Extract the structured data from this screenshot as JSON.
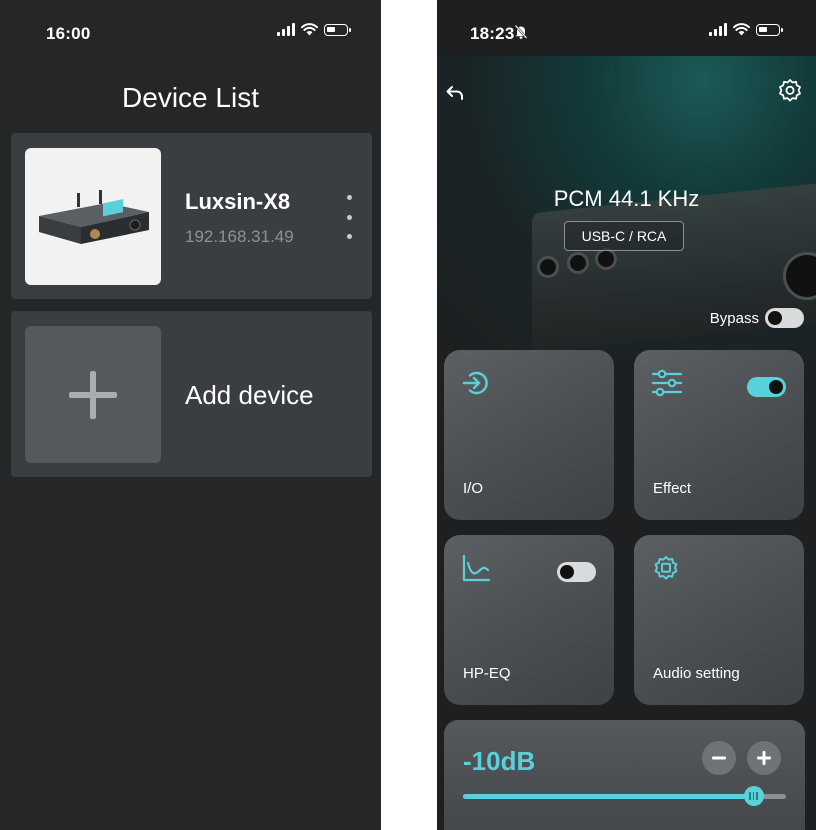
{
  "device_list_screen": {
    "status_time": "16:00",
    "title": "Device List",
    "devices": [
      {
        "name": "Luxsin-X8",
        "ip": "192.168.31.49"
      }
    ],
    "add_label": "Add device"
  },
  "device_control_screen": {
    "status_time": "18:23",
    "format": "PCM 44.1 KHz",
    "source": "USB-C / RCA",
    "bypass_label": "Bypass",
    "bypass_on": false,
    "tiles": [
      {
        "label": "I/O",
        "icon": "input-arrow-icon"
      },
      {
        "label": "Effect",
        "icon": "sliders-icon",
        "toggle_on": true
      },
      {
        "label": "HP-EQ",
        "icon": "eq-curve-icon",
        "toggle_on": false
      },
      {
        "label": "Audio setting",
        "icon": "chip-gear-icon"
      }
    ],
    "volume": {
      "value_label": "-10dB",
      "level_percent": 90
    }
  },
  "colors": {
    "accent": "#5ad1da",
    "card": "#3a3d41",
    "background": "#252628"
  }
}
